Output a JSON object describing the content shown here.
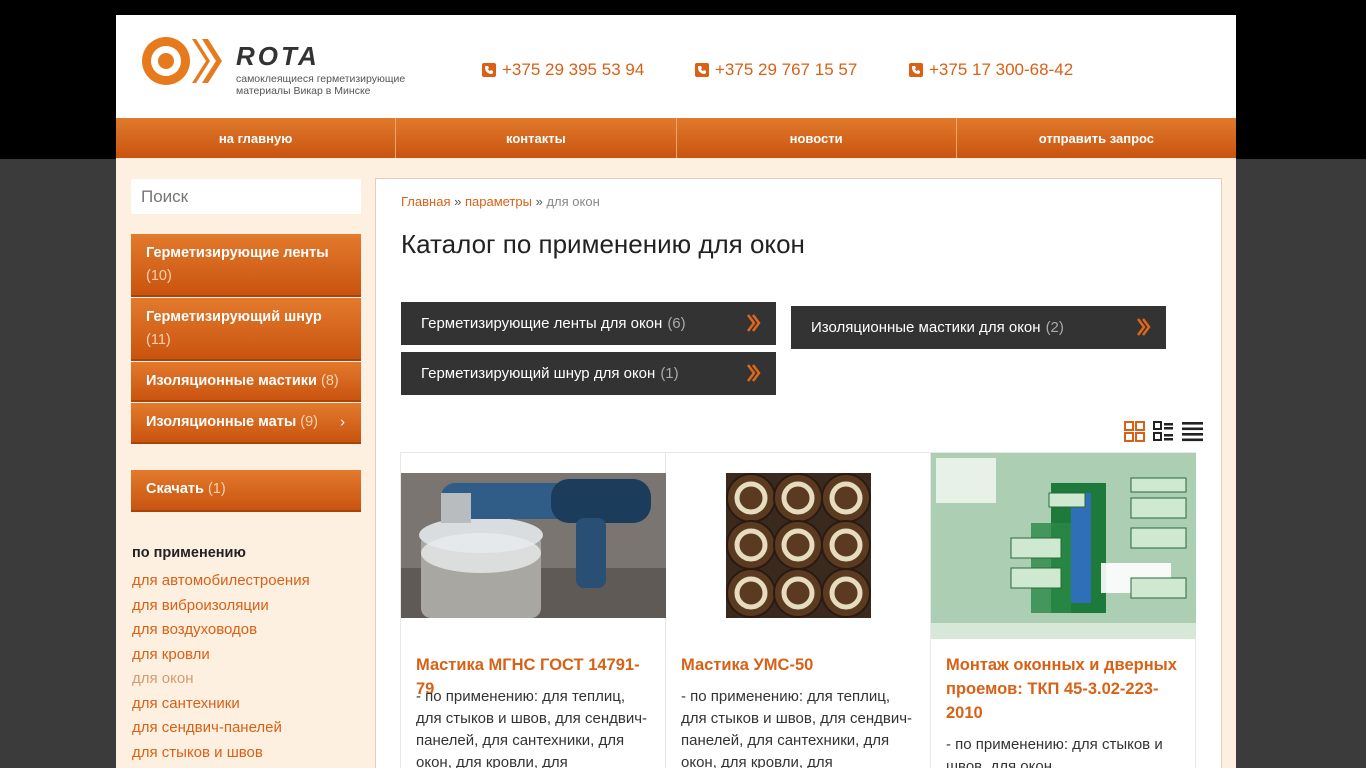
{
  "header": {
    "logo_text": "ROTA",
    "tagline": "самоклеящиеся герметизирующие материалы Викар в Минске",
    "phones": [
      "+375 29 395 53 94",
      "+375 29 767 15 57",
      "+375 17 300-68-42"
    ]
  },
  "nav": {
    "home": "на главную",
    "contacts": "контакты",
    "news": "новости",
    "request": "отправить запрос"
  },
  "search": {
    "placeholder": "Поиск"
  },
  "sidebar": {
    "categories": [
      {
        "label": "Герметизирующие ленты",
        "count": "(10)"
      },
      {
        "label": "Герметизирующий шнур",
        "count": "(11)"
      },
      {
        "label": "Изоляционные мастики",
        "count": "(8)"
      },
      {
        "label": "Изоляционные маты",
        "count": "(9)"
      }
    ],
    "download": {
      "label": "Скачать",
      "count": "(1)"
    },
    "filter_title": "по применению",
    "filters": [
      "для автомобилестроения",
      "для виброизоляции",
      "для воздуховодов",
      "для кровли",
      "для окон",
      "для сантехники",
      "для сендвич-панелей",
      "для стыков и швов"
    ]
  },
  "breadcrumb": {
    "home": "Главная",
    "params": "параметры",
    "current": "для окон"
  },
  "page_title": "Каталог по применению для окон",
  "app_buttons": [
    {
      "label": "Герметизирующие ленты для окон",
      "count": "(6)"
    },
    {
      "label": "Изоляционные мастики для окон",
      "count": "(2)"
    },
    {
      "label": "Герметизирующий шнур для окон",
      "count": "(1)"
    }
  ],
  "products": [
    {
      "name": "Мастика МГНС ГОСТ 14791-79",
      "desc": "- по применению: для теплиц, для стыков и швов, для сендвич-панелей, для сантехники, для окон, для кровли, для"
    },
    {
      "name": "Мастика УМС-50",
      "desc": "- по применению: для теплиц, для стыков и швов, для сендвич-панелей, для сантехники, для окон, для кровли, для"
    },
    {
      "name": "Монтаж оконных и дверных проемов: ТКП 45-3.02-223-2010",
      "desc": "- по применению: для стыков и швов, для окон"
    }
  ],
  "colors": {
    "accent": "#d86116",
    "nav": "#c9540f",
    "dark_button": "#333333"
  }
}
